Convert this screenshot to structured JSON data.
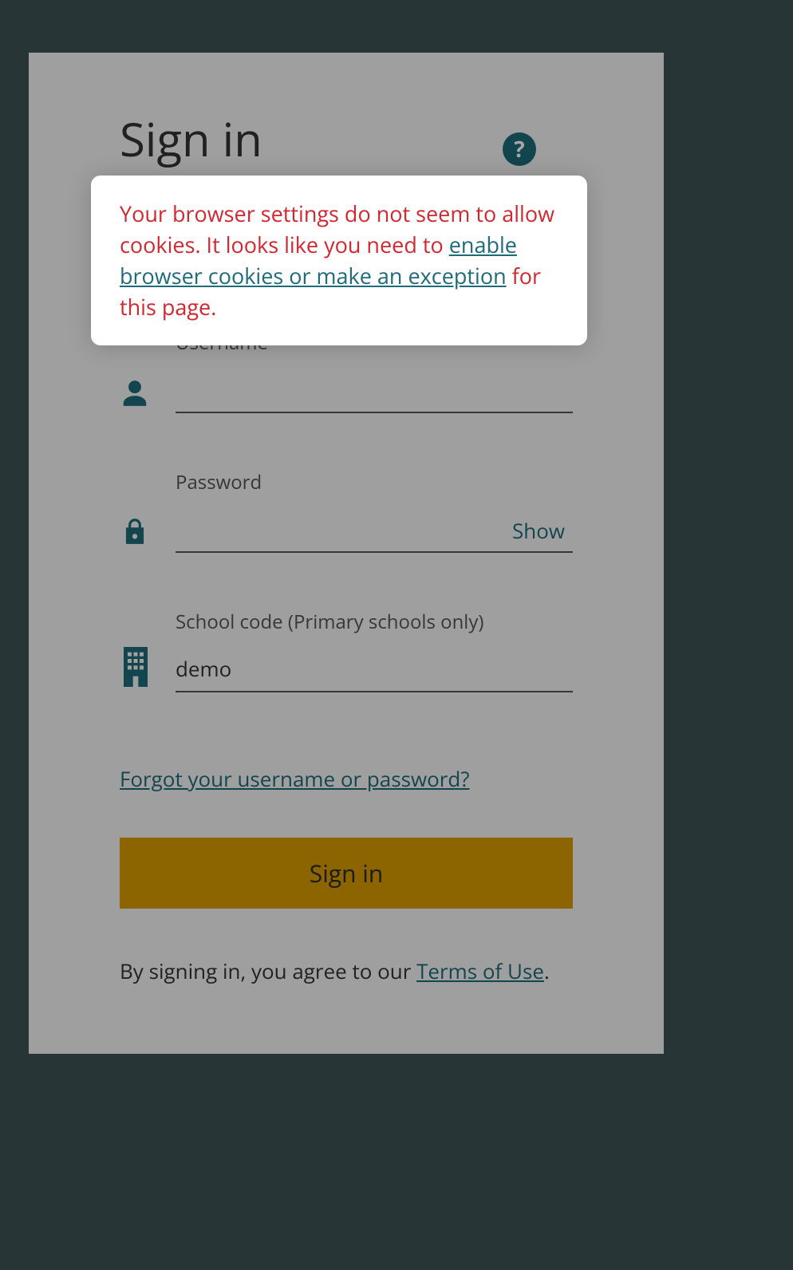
{
  "title": "Sign in",
  "help_icon": "?",
  "alert": {
    "text_before": "Your browser settings do not seem to allow cookies. It looks like you need to ",
    "link_text": "enable browser cookies or make an exception",
    "text_after": " for this page."
  },
  "fields": {
    "username": {
      "label": "Username",
      "value": ""
    },
    "password": {
      "label": "Password",
      "value": "",
      "show_toggle": "Show"
    },
    "schoolcode": {
      "label": "School code (Primary schools only)",
      "value": "demo"
    }
  },
  "forgot_link": "Forgot your username or password?",
  "signin_button": "Sign in",
  "terms": {
    "prefix": "By signing in, you agree to our ",
    "link": "Terms of Use",
    "suffix": "."
  },
  "colors": {
    "accent": "#1e6b7a",
    "error": "#d22730",
    "button": "#d79a00"
  }
}
